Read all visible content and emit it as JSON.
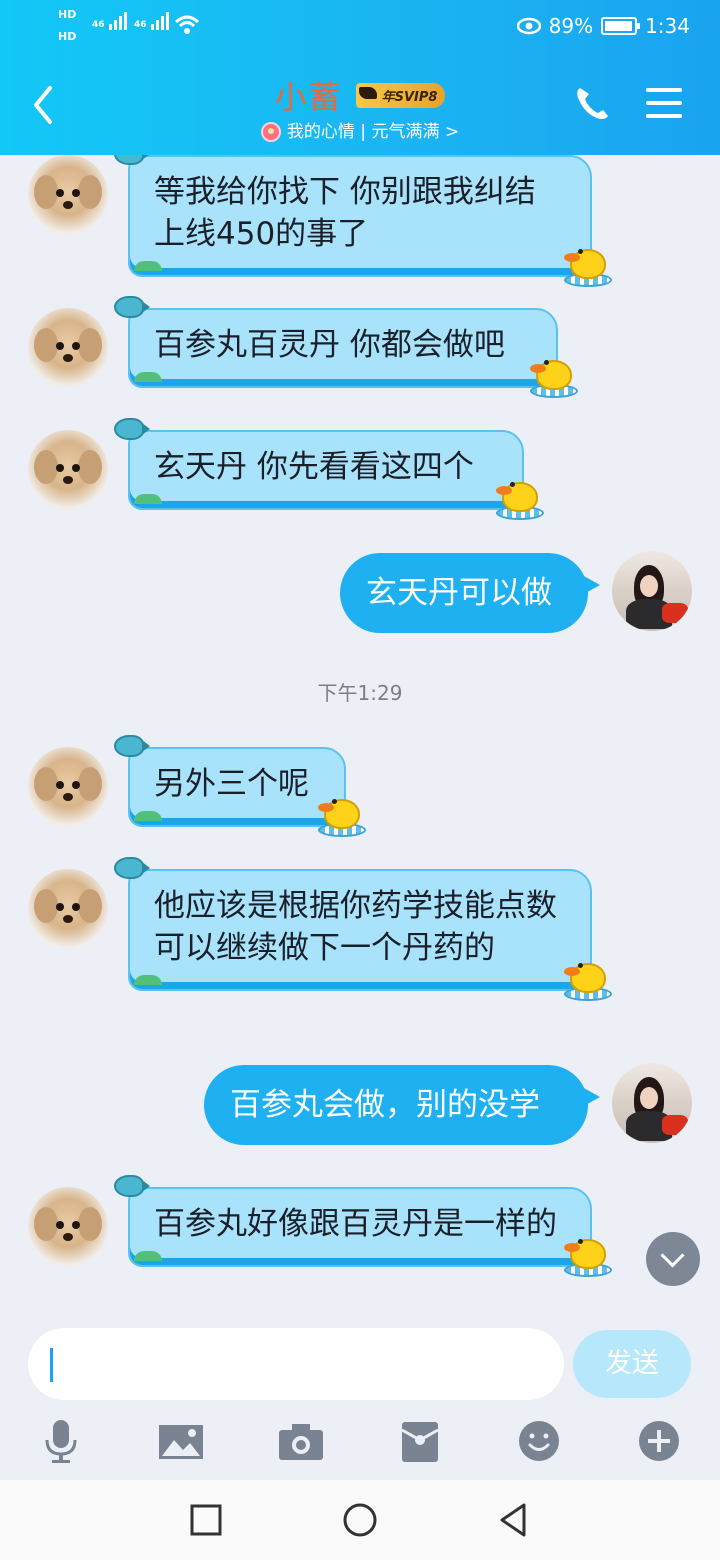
{
  "status_bar": {
    "battery_percent": "89%",
    "time": "1:34",
    "signal_labels": [
      "46",
      "46"
    ]
  },
  "header": {
    "title": "小蓄",
    "badge": "年SVIP8",
    "mood": "我的心情 | 元气满满 >"
  },
  "messages": [
    {
      "side": "in",
      "text": "等我给你找下 你别跟我纠结上线450的事了"
    },
    {
      "side": "in",
      "text": "百参丸百灵丹 你都会做吧"
    },
    {
      "side": "in",
      "text": "玄天丹 你先看看这四个"
    },
    {
      "side": "out",
      "text": "玄天丹可以做"
    },
    {
      "side": "time",
      "text": "下午1:29"
    },
    {
      "side": "in",
      "text": "另外三个呢"
    },
    {
      "side": "in",
      "text": "他应该是根据你药学技能点数 可以继续做下一个丹药的"
    },
    {
      "side": "out",
      "text": "百参丸会做，别的没学"
    },
    {
      "side": "in",
      "text": "百参丸好像跟百灵丹是一样的"
    }
  ],
  "composer": {
    "value": "",
    "send_label": "发送"
  },
  "toolbar": {
    "icons": [
      "microphone-icon",
      "image-icon",
      "camera-icon",
      "red-packet-icon",
      "emoji-icon",
      "plus-icon"
    ]
  },
  "colors": {
    "header": "#1ab5f2",
    "bubble_out": "#1eb0f1",
    "bubble_in": "#a9e3fb",
    "title": "#e56b3b"
  }
}
